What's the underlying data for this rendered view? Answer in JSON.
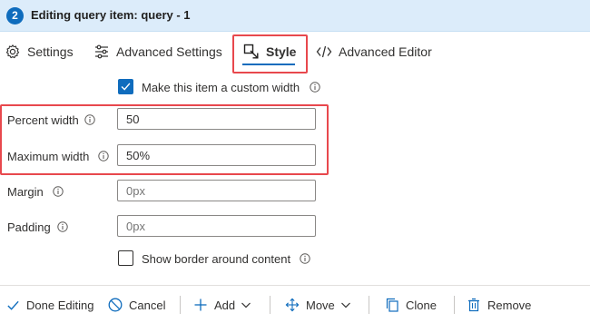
{
  "header": {
    "step": "2",
    "title": "Editing query item: query - 1"
  },
  "tabs": {
    "settings": "Settings",
    "advanced_settings": "Advanced Settings",
    "style": "Style",
    "advanced_editor": "Advanced Editor",
    "active": "style"
  },
  "form": {
    "custom_width": {
      "label": "Make this item a custom width",
      "checked": true
    },
    "percent_width": {
      "label": "Percent width",
      "value": "50"
    },
    "maximum_width": {
      "label": "Maximum width",
      "value": "50%"
    },
    "margin": {
      "label": "Margin",
      "placeholder": "0px"
    },
    "padding": {
      "label": "Padding",
      "placeholder": "0px"
    },
    "show_border": {
      "label": "Show border around content",
      "checked": false
    }
  },
  "toolbar": {
    "done": "Done Editing",
    "cancel": "Cancel",
    "add": "Add",
    "move": "Move",
    "clone": "Clone",
    "remove": "Remove"
  },
  "colors": {
    "accent": "#0f6cbd",
    "header_bg": "#dcecfa",
    "highlight": "#e8484d"
  }
}
